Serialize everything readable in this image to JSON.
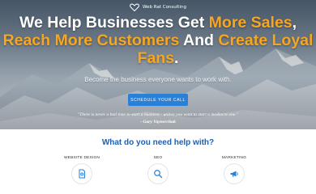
{
  "brand": {
    "name": "Web Rat Consulting",
    "logo_icon": "heart-logo-icon"
  },
  "hero": {
    "headline": {
      "part1": "We Help Businesses Get ",
      "accent1": "More Sales",
      "part2": ",",
      "accent2": "Reach More Customers",
      "part3": " And ",
      "accent3": "Create Loyal",
      "accent4": "Fans",
      "part4": "."
    },
    "subtext": "Become the business everyone wants to work with.",
    "cta_label": "SCHEDULE YOUR CALL",
    "quote": "\"There is never a bad time to start a business - unless you want to start a mediocre one.\"",
    "quote_author": "- Gary Vaynerchuk"
  },
  "services": {
    "title": "What do you need help with?",
    "items": [
      {
        "label": "WEBSITE DESIGN",
        "icon": "website-design-icon"
      },
      {
        "label": "SEO",
        "icon": "search-icon"
      },
      {
        "label": "MARKETING",
        "icon": "megaphone-icon"
      }
    ]
  },
  "colors": {
    "accent": "#f5a623",
    "primary": "#2a7fd6",
    "title_blue": "#1f5fb0"
  }
}
